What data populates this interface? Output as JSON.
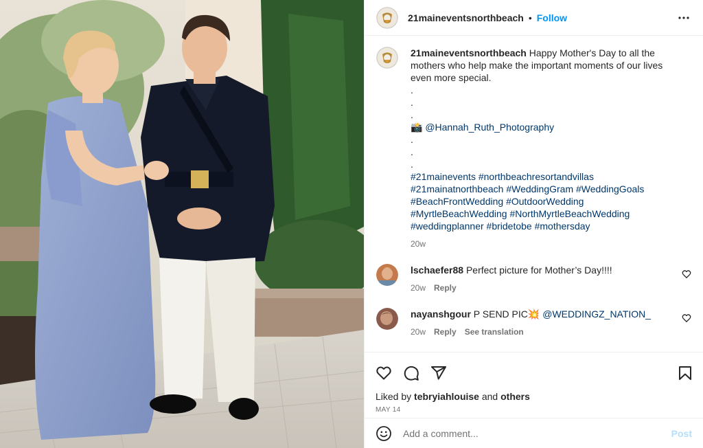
{
  "header": {
    "username": "21maineventsnorthbeach",
    "separator": "•",
    "follow_label": "Follow",
    "more_icon": "more-horizontal-icon"
  },
  "caption": {
    "username": "21maineventsnorthbeach",
    "text": "Happy Mother's Day to all the mothers who help make the important moments of our lives even more special.",
    "dots_a": [
      ".",
      ".",
      "."
    ],
    "camera_emoji": "📸",
    "photo_credit": "@Hannah_Ruth_Photography",
    "dots_b": [
      ".",
      ".",
      "."
    ],
    "hashtags": [
      [
        "#21mainevents",
        "#northbeachresortandvillas"
      ],
      [
        "#21mainatnorthbeach",
        "#WeddingGram",
        "#WeddingGoals"
      ],
      [
        "#BeachFrontWedding",
        "#OutdoorWedding"
      ],
      [
        "#MyrtleBeachWedding",
        "#NorthMyrtleBeachWedding"
      ],
      [
        "#weddingplanner",
        "#bridetobe",
        "#mothersday"
      ]
    ],
    "time": "20w"
  },
  "comments": [
    {
      "username": "lschaefer88",
      "text": "Perfect picture for Mother’s Day!!!!",
      "time": "20w",
      "reply_label": "Reply",
      "translation_label": ""
    },
    {
      "username": "nayanshgour",
      "text": "P SEND PIC",
      "emoji": "💥",
      "mention": "@WEDDINGZ_NATION_",
      "time": "20w",
      "reply_label": "Reply",
      "translation_label": "See translation"
    }
  ],
  "actions": {
    "liked_prefix": "Liked by",
    "liked_user": "tebryiahlouise",
    "liked_and": "and",
    "liked_others": "others",
    "date": "MAY 14"
  },
  "add_comment": {
    "placeholder": "Add a comment...",
    "post_label": "Post"
  },
  "colors": {
    "link_blue": "#0095f6",
    "hashtag_blue": "#00376b",
    "muted": "#737373",
    "post_disabled": "#b2dffc"
  }
}
